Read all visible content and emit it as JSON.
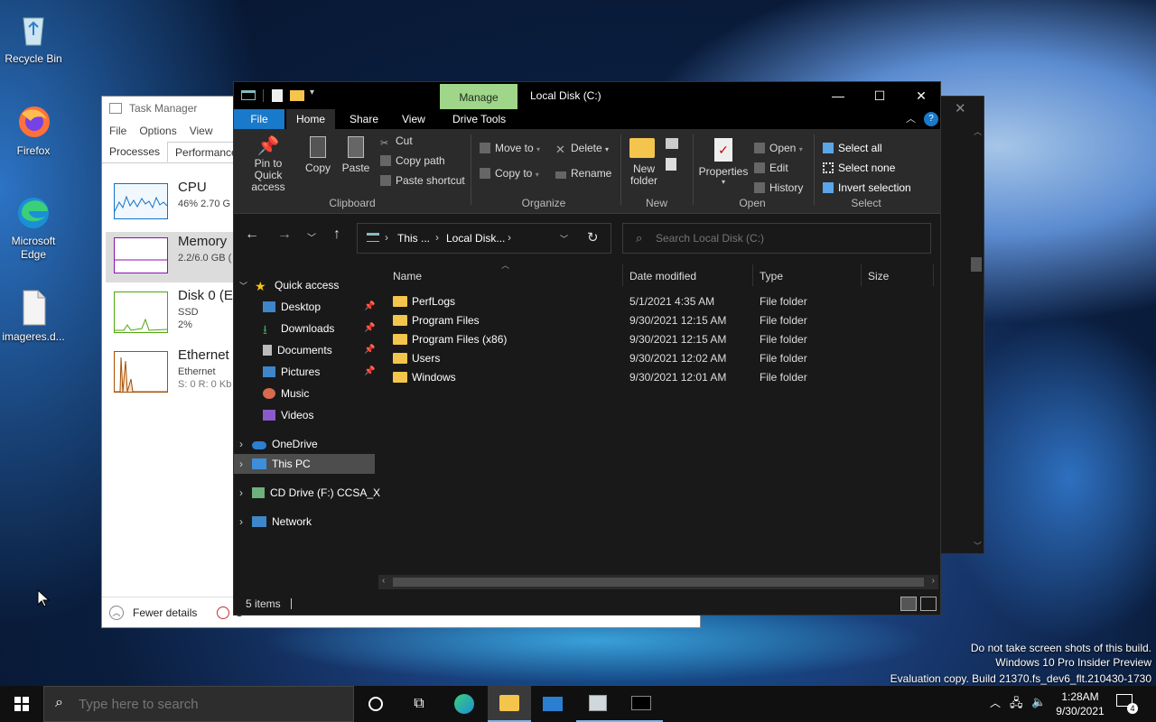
{
  "desktop": {
    "icons": [
      {
        "label": "Recycle Bin"
      },
      {
        "label": "Firefox"
      },
      {
        "label": "Microsoft Edge"
      },
      {
        "label": "imageres.d..."
      }
    ],
    "watermark": [
      "Do not take screen shots of this build.",
      "Windows 10 Pro Insider Preview",
      "Evaluation copy. Build 21370.fs_dev6_flt.210430-1730"
    ]
  },
  "task_manager": {
    "title": "Task Manager",
    "menu": [
      "File",
      "Options",
      "View"
    ],
    "tabs": [
      "Processes",
      "Performance"
    ],
    "perf": [
      {
        "name": "CPU",
        "line1": "46%  2.70 G",
        "line2": ""
      },
      {
        "name": "Memory",
        "line1": "2.2/6.0 GB (",
        "line2": ""
      },
      {
        "name": "Disk 0 (E",
        "line1": "SSD",
        "line2": "2%"
      },
      {
        "name": "Ethernet",
        "line1": "Ethernet",
        "line2": "S: 0 R: 0 Kb"
      }
    ],
    "fewer_details": "Fewer details",
    "open_rm": "O"
  },
  "explorer": {
    "manage": "Manage",
    "title": "Local Disk (C:)",
    "ribbon_tabs": [
      "File",
      "Home",
      "Share",
      "View",
      "Drive Tools"
    ],
    "clipboard": {
      "pin": "Pin to Quick access",
      "copy": "Copy",
      "paste": "Paste",
      "cut": "Cut",
      "copy_path": "Copy path",
      "paste_shortcut": "Paste shortcut",
      "group": "Clipboard"
    },
    "organize": {
      "move_to": "Move to",
      "copy_to": "Copy to",
      "delete": "Delete",
      "rename": "Rename",
      "group": "Organize"
    },
    "new": {
      "new_folder": "New folder",
      "group": "New"
    },
    "open": {
      "properties": "Properties",
      "open": "Open",
      "edit": "Edit",
      "history": "History",
      "group": "Open"
    },
    "select": {
      "all": "Select all",
      "none": "Select none",
      "invert": "Invert selection",
      "group": "Select"
    },
    "address": {
      "crumb1": "This ...",
      "crumb2": "Local Disk...",
      "search_placeholder": "Search Local Disk (C:)"
    },
    "tree": [
      {
        "label": "Quick access"
      },
      {
        "label": "Desktop"
      },
      {
        "label": "Downloads"
      },
      {
        "label": "Documents"
      },
      {
        "label": "Pictures"
      },
      {
        "label": "Music"
      },
      {
        "label": "Videos"
      },
      {
        "label": "OneDrive"
      },
      {
        "label": "This PC"
      },
      {
        "label": "CD Drive (F:) CCSA_X"
      },
      {
        "label": "Network"
      }
    ],
    "columns": [
      "Name",
      "Date modified",
      "Type",
      "Size"
    ],
    "files": [
      {
        "name": "PerfLogs",
        "date": "5/1/2021 4:35 AM",
        "type": "File folder"
      },
      {
        "name": "Program Files",
        "date": "9/30/2021 12:15 AM",
        "type": "File folder"
      },
      {
        "name": "Program Files (x86)",
        "date": "9/30/2021 12:15 AM",
        "type": "File folder"
      },
      {
        "name": "Users",
        "date": "9/30/2021 12:02 AM",
        "type": "File folder"
      },
      {
        "name": "Windows",
        "date": "9/30/2021 12:01 AM",
        "type": "File folder"
      }
    ],
    "status": "5 items"
  },
  "taskbar": {
    "search_placeholder": "Type here to search",
    "time": "1:28AM",
    "date": "9/30/2021",
    "notifications": "4"
  },
  "colors": {
    "manage_tab": "#9fd689",
    "file_tab": "#1979ca",
    "folder": "#f3c54c",
    "selected": "#4d4d4d"
  }
}
